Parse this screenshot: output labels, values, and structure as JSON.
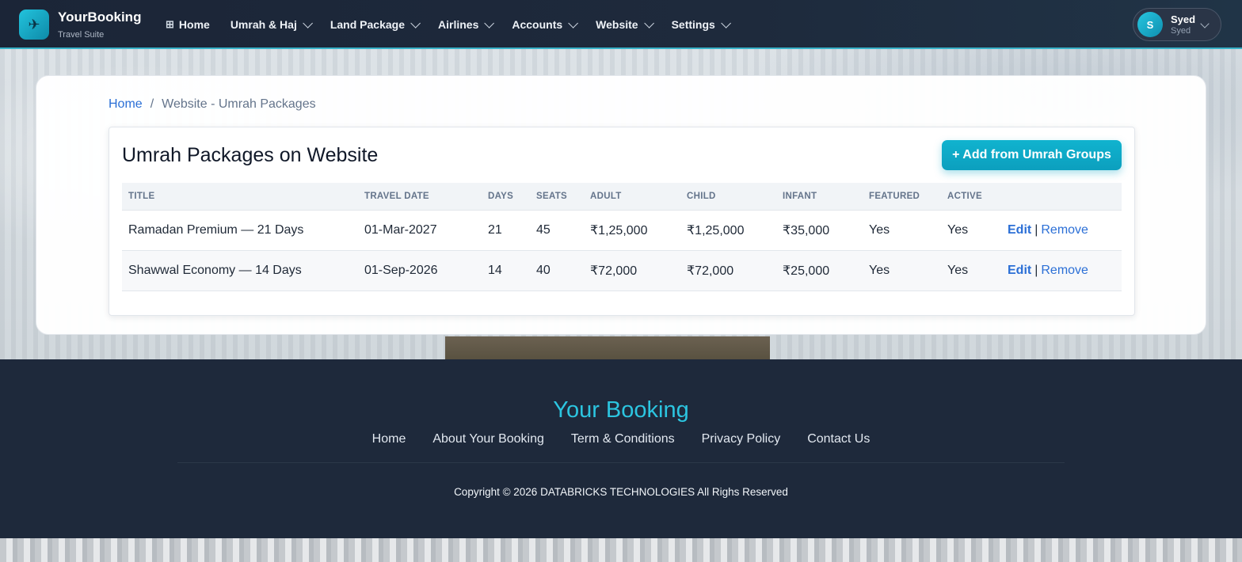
{
  "brand": {
    "name": "YourBooking",
    "subtitle": "Travel Suite",
    "logo_icon": "plane-icon"
  },
  "nav": [
    {
      "label": "Home",
      "icon": "grid-icon",
      "has_dropdown": false
    },
    {
      "label": "Umrah & Haj",
      "has_dropdown": true
    },
    {
      "label": "Land Package",
      "has_dropdown": true
    },
    {
      "label": "Airlines",
      "has_dropdown": true
    },
    {
      "label": "Accounts",
      "has_dropdown": true
    },
    {
      "label": "Website",
      "has_dropdown": true
    },
    {
      "label": "Settings",
      "has_dropdown": true
    }
  ],
  "user": {
    "initial": "S",
    "name": "Syed",
    "role": "Syed"
  },
  "breadcrumb": {
    "home": "Home",
    "separator": "/",
    "current": "Website - Umrah Packages"
  },
  "panel": {
    "title": "Umrah Packages on Website",
    "add_button": "+ Add from Umrah Groups",
    "columns": [
      "TITLE",
      "TRAVEL DATE",
      "DAYS",
      "SEATS",
      "ADULT",
      "CHILD",
      "INFANT",
      "FEATURED",
      "ACTIVE",
      ""
    ],
    "rows": [
      {
        "title": "Ramadan Premium — 21 Days",
        "travel_date": "01-Mar-2027",
        "days": "21",
        "seats": "45",
        "adult": "₹1,25,000",
        "child": "₹1,25,000",
        "infant": "₹35,000",
        "featured": "Yes",
        "active": "Yes",
        "edit": "Edit",
        "sep": "|",
        "remove": "Remove"
      },
      {
        "title": "Shawwal Economy — 14 Days",
        "travel_date": "01-Sep-2026",
        "days": "14",
        "seats": "40",
        "adult": "₹72,000",
        "child": "₹72,000",
        "infant": "₹25,000",
        "featured": "Yes",
        "active": "Yes",
        "edit": "Edit",
        "sep": "|",
        "remove": "Remove"
      }
    ]
  },
  "footer": {
    "brand": "Your Booking",
    "links": [
      "Home",
      "About Your Booking",
      "Term & Conditions",
      "Privacy Policy",
      "Contact Us"
    ],
    "copyright": "Copyright © 2026 DATABRICKS TECHNOLOGIES All Righs Reserved"
  },
  "colors": {
    "navbar": "#1e293b",
    "accent": "#0ea5c7",
    "link": "#2b6fd6",
    "footer": "#1e293b"
  }
}
